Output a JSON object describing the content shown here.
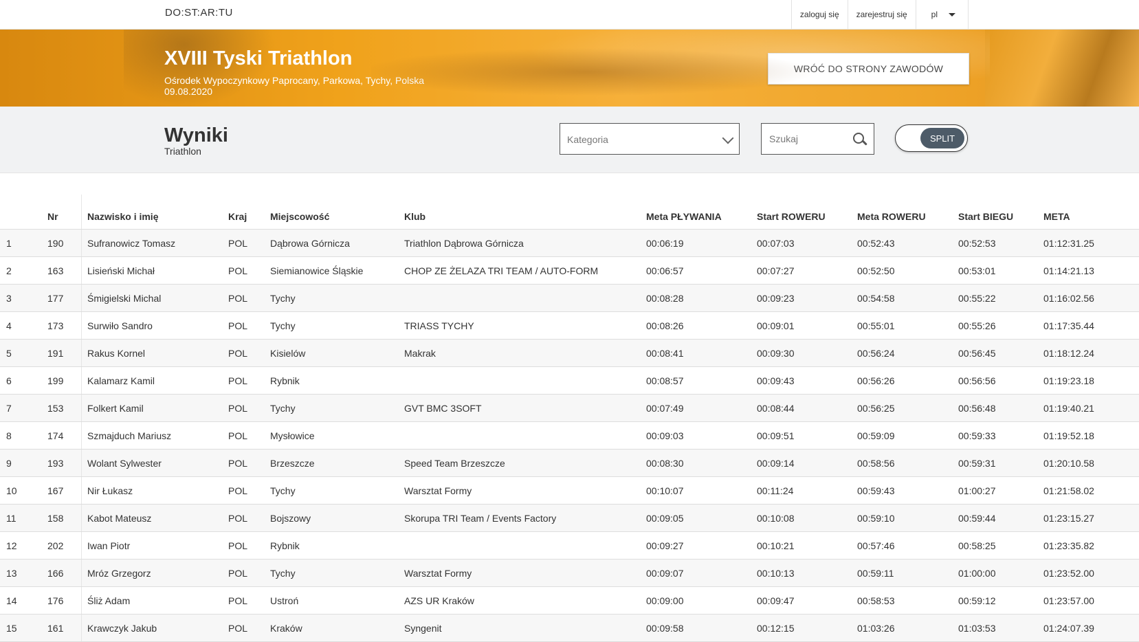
{
  "header": {
    "logo": "DO:ST:AR:TU",
    "login": "zaloguj się",
    "register": "zarejestruj się",
    "lang": "pl"
  },
  "hero": {
    "title": "XVIII Tyski Triathlon",
    "location": "Ośrodek Wypoczynkowy Paprocany, Parkowa, Tychy, Polska",
    "date": "09.08.2020",
    "back_button": "WRÓĆ DO STRONY ZAWODÓW"
  },
  "toolbar": {
    "title": "Wyniki",
    "subtitle": "Triathlon",
    "category_placeholder": "Kategoria",
    "search_placeholder": "Szukaj",
    "toggle_label": "SPLIT"
  },
  "table": {
    "headers": [
      "",
      "Nr",
      "Nazwisko i imię",
      "Kraj",
      "Miejscowość",
      "Klub",
      "Meta PŁYWANIA",
      "Start ROWERU",
      "Meta ROWERU",
      "Start BIEGU",
      "META"
    ],
    "rows": [
      [
        "1",
        "190",
        "Sufranowicz Tomasz",
        "POL",
        "Dąbrowa Górnicza",
        "Triathlon Dąbrowa Górnicza",
        "00:06:19",
        "00:07:03",
        "00:52:43",
        "00:52:53",
        "01:12:31.25"
      ],
      [
        "2",
        "163",
        "Lisieński Michał",
        "POL",
        "Siemianowice Śląskie",
        "CHOP ZE ŻELAZA TRI TEAM / AUTO-FORM",
        "00:06:57",
        "00:07:27",
        "00:52:50",
        "00:53:01",
        "01:14:21.13"
      ],
      [
        "3",
        "177",
        "Śmigielski Michal",
        "POL",
        "Tychy",
        "",
        "00:08:28",
        "00:09:23",
        "00:54:58",
        "00:55:22",
        "01:16:02.56"
      ],
      [
        "4",
        "173",
        "Surwiło Sandro",
        "POL",
        "Tychy",
        "TRIASS TYCHY",
        "00:08:26",
        "00:09:01",
        "00:55:01",
        "00:55:26",
        "01:17:35.44"
      ],
      [
        "5",
        "191",
        "Rakus Kornel",
        "POL",
        "Kisielów",
        "Makrak",
        "00:08:41",
        "00:09:30",
        "00:56:24",
        "00:56:45",
        "01:18:12.24"
      ],
      [
        "6",
        "199",
        "Kalamarz Kamil",
        "POL",
        "Rybnik",
        "",
        "00:08:57",
        "00:09:43",
        "00:56:26",
        "00:56:56",
        "01:19:23.18"
      ],
      [
        "7",
        "153",
        "Folkert Kamil",
        "POL",
        "Tychy",
        "GVT BMC 3SOFT",
        "00:07:49",
        "00:08:44",
        "00:56:25",
        "00:56:48",
        "01:19:40.21"
      ],
      [
        "8",
        "174",
        "Szmajduch Mariusz",
        "POL",
        "Mysłowice",
        "",
        "00:09:03",
        "00:09:51",
        "00:59:09",
        "00:59:33",
        "01:19:52.18"
      ],
      [
        "9",
        "193",
        "Wolant Sylwester",
        "POL",
        "Brzeszcze",
        "Speed Team Brzeszcze",
        "00:08:30",
        "00:09:14",
        "00:58:56",
        "00:59:31",
        "01:20:10.58"
      ],
      [
        "10",
        "167",
        "Nir Łukasz",
        "POL",
        "Tychy",
        "Warsztat Formy",
        "00:10:07",
        "00:11:24",
        "00:59:43",
        "01:00:27",
        "01:21:58.02"
      ],
      [
        "11",
        "158",
        "Kabot Mateusz",
        "POL",
        "Bojszowy",
        "Skorupa TRI Team / Events Factory",
        "00:09:05",
        "00:10:08",
        "00:59:10",
        "00:59:44",
        "01:23:15.27"
      ],
      [
        "12",
        "202",
        "Iwan Piotr",
        "POL",
        "Rybnik",
        "",
        "00:09:27",
        "00:10:21",
        "00:57:46",
        "00:58:25",
        "01:23:35.82"
      ],
      [
        "13",
        "166",
        "Mróz Grzegorz",
        "POL",
        "Tychy",
        "Warsztat Formy",
        "00:09:07",
        "00:10:13",
        "00:59:11",
        "01:00:00",
        "01:23:52.00"
      ],
      [
        "14",
        "176",
        "Śliż Adam",
        "POL",
        "Ustroń",
        "AZS UR Kraków",
        "00:09:00",
        "00:09:47",
        "00:58:53",
        "00:59:12",
        "01:23:57.00"
      ],
      [
        "15",
        "161",
        "Krawczyk Jakub",
        "POL",
        "Kraków",
        "Syngenit",
        "00:09:58",
        "00:12:15",
        "01:03:26",
        "01:03:53",
        "01:24:07.39"
      ]
    ]
  }
}
